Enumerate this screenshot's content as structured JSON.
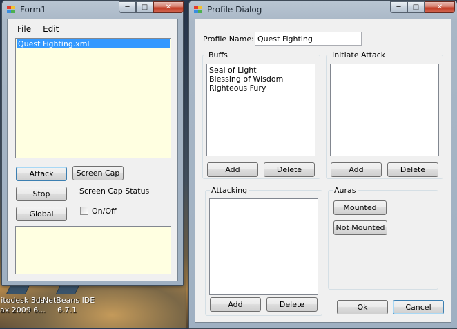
{
  "desktop": {
    "icons": [
      {
        "line1": "itodesk 3ds",
        "line2": "ax 2009 6..."
      },
      {
        "line1": "NetBeans IDE",
        "line2": "6.7.1"
      }
    ]
  },
  "form1": {
    "title": "Form1",
    "menu": [
      "File",
      "Edit"
    ],
    "profiles": [
      "Quest Fighting.xml"
    ],
    "buttons": {
      "attack": "Attack",
      "screen_cap": "Screen Cap",
      "stop": "Stop",
      "global": "Global"
    },
    "screen_cap_status": "Screen Cap Status",
    "onoff_label": "On/Off",
    "onoff_checked": false
  },
  "profile_dialog": {
    "title": "Profile Dialog",
    "profile_name_label": "Profile Name:",
    "profile_name_value": "Quest Fighting",
    "buffs": {
      "title": "Buffs",
      "items": [
        "Seal of Light",
        "Blessing of Wisdom",
        "Righteous Fury"
      ],
      "add": "Add",
      "delete": "Delete"
    },
    "initiate_attack": {
      "title": "Initiate Attack",
      "items": [],
      "add": "Add",
      "delete": "Delete"
    },
    "attacking": {
      "title": "Attacking",
      "items": [],
      "add": "Add",
      "delete": "Delete"
    },
    "auras": {
      "title": "Auras",
      "mounted": "Mounted",
      "not_mounted": "Not Mounted"
    },
    "ok": "Ok",
    "cancel": "Cancel"
  }
}
